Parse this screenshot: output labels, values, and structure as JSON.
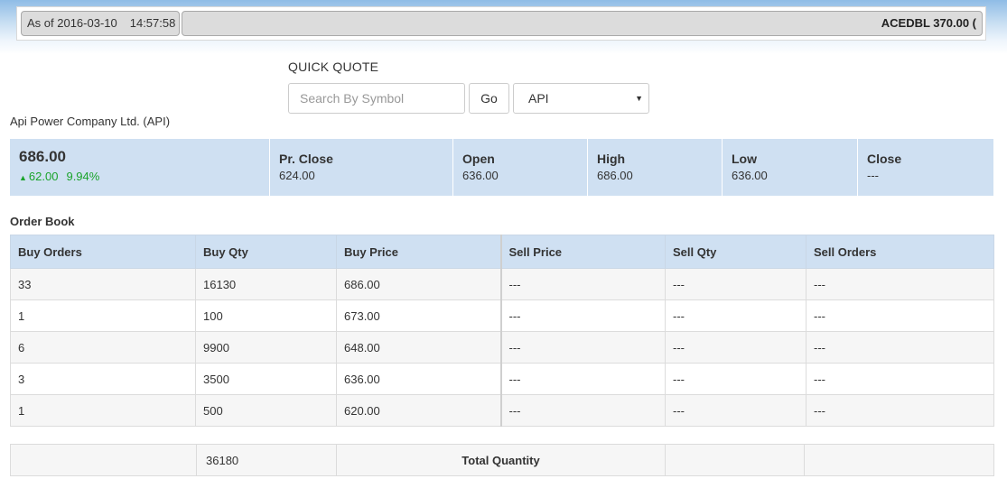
{
  "ticker_bar": {
    "as_of_label": "As of 2016-03-10",
    "as_of_time": "14:57:58",
    "scroll_text": "ACEDBL 370.00 ("
  },
  "quick_quote": {
    "title": "QUICK QUOTE",
    "search_placeholder": "Search By Symbol",
    "go_label": "Go",
    "selected_symbol": "API"
  },
  "company": {
    "name": "Api Power Company Ltd. (API)"
  },
  "quote": {
    "ltp": "686.00",
    "change": "62.00",
    "change_pct": "9.94%",
    "change_direction": "up",
    "change_color": "#1aa32b",
    "fields": [
      {
        "label": "Pr. Close",
        "value": "624.00"
      },
      {
        "label": "Open",
        "value": "636.00"
      },
      {
        "label": "High",
        "value": "686.00"
      },
      {
        "label": "Low",
        "value": "636.00"
      },
      {
        "label": "Close",
        "value": "---"
      }
    ]
  },
  "order_book": {
    "title": "Order Book",
    "headers": [
      "Buy Orders",
      "Buy Qty",
      "Buy Price",
      "Sell Price",
      "Sell Qty",
      "Sell Orders"
    ],
    "rows": [
      [
        "33",
        "16130",
        "686.00",
        "---",
        "---",
        "---"
      ],
      [
        "1",
        "100",
        "673.00",
        "---",
        "---",
        "---"
      ],
      [
        "6",
        "9900",
        "648.00",
        "---",
        "---",
        "---"
      ],
      [
        "3",
        "3500",
        "636.00",
        "---",
        "---",
        "---"
      ],
      [
        "1",
        "500",
        "620.00",
        "---",
        "---",
        "---"
      ]
    ],
    "total": {
      "buy_qty": "36180",
      "label": "Total Quantity"
    }
  },
  "colors": {
    "header_bg": "#cfe0f2",
    "accent_gain": "#1aa32b"
  }
}
